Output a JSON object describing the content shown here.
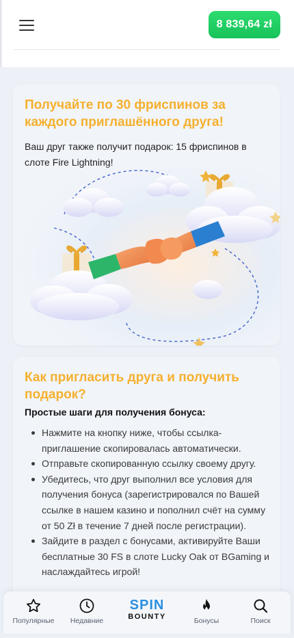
{
  "header": {
    "menu_icon": "hamburger-menu-icon",
    "balance": "8 839,64 zł",
    "balance_color": "#1ecb63"
  },
  "promo": {
    "title": "Получайте по 30 фриспинов за каждого приглашённого друга!",
    "subtitle": "Ваш друг также получит подарок: 15 фриспинов в слоте Fire Lightning!"
  },
  "how_to": {
    "title": "Как пригласить друга и получить подарок?",
    "steps_heading": "Простые шаги для получения бонуса:",
    "steps": [
      "Нажмите на кнопку ниже, чтобы ссылка-приглашение скопировалась автоматически.",
      "Отправьте скопированную ссылку своему другу.",
      "Убедитесь, что друг выполнил все условия для получения бонуса (зарегистрировался по Вашей ссылке в нашем казино и пополнил счёт на сумму от 50 Zł в течение 7 дней после регистрации).",
      "Зайдите в раздел с бонусами, активируйте Ваши бесплатные 30 FS в слоте Lucky Oak от BGaming и наслаждайтесь игрой!"
    ]
  },
  "accent_color": "#f5b02e",
  "bottom_nav": {
    "items": [
      {
        "label": "Популярные",
        "icon": "star-icon"
      },
      {
        "label": "Недавние",
        "icon": "clock-icon"
      },
      {
        "label": "Бонусы",
        "icon": "flame-icon"
      },
      {
        "label": "Поиск",
        "icon": "search-icon"
      }
    ],
    "logo": {
      "line1": "SPIN",
      "line2": "BOUNTY"
    }
  }
}
